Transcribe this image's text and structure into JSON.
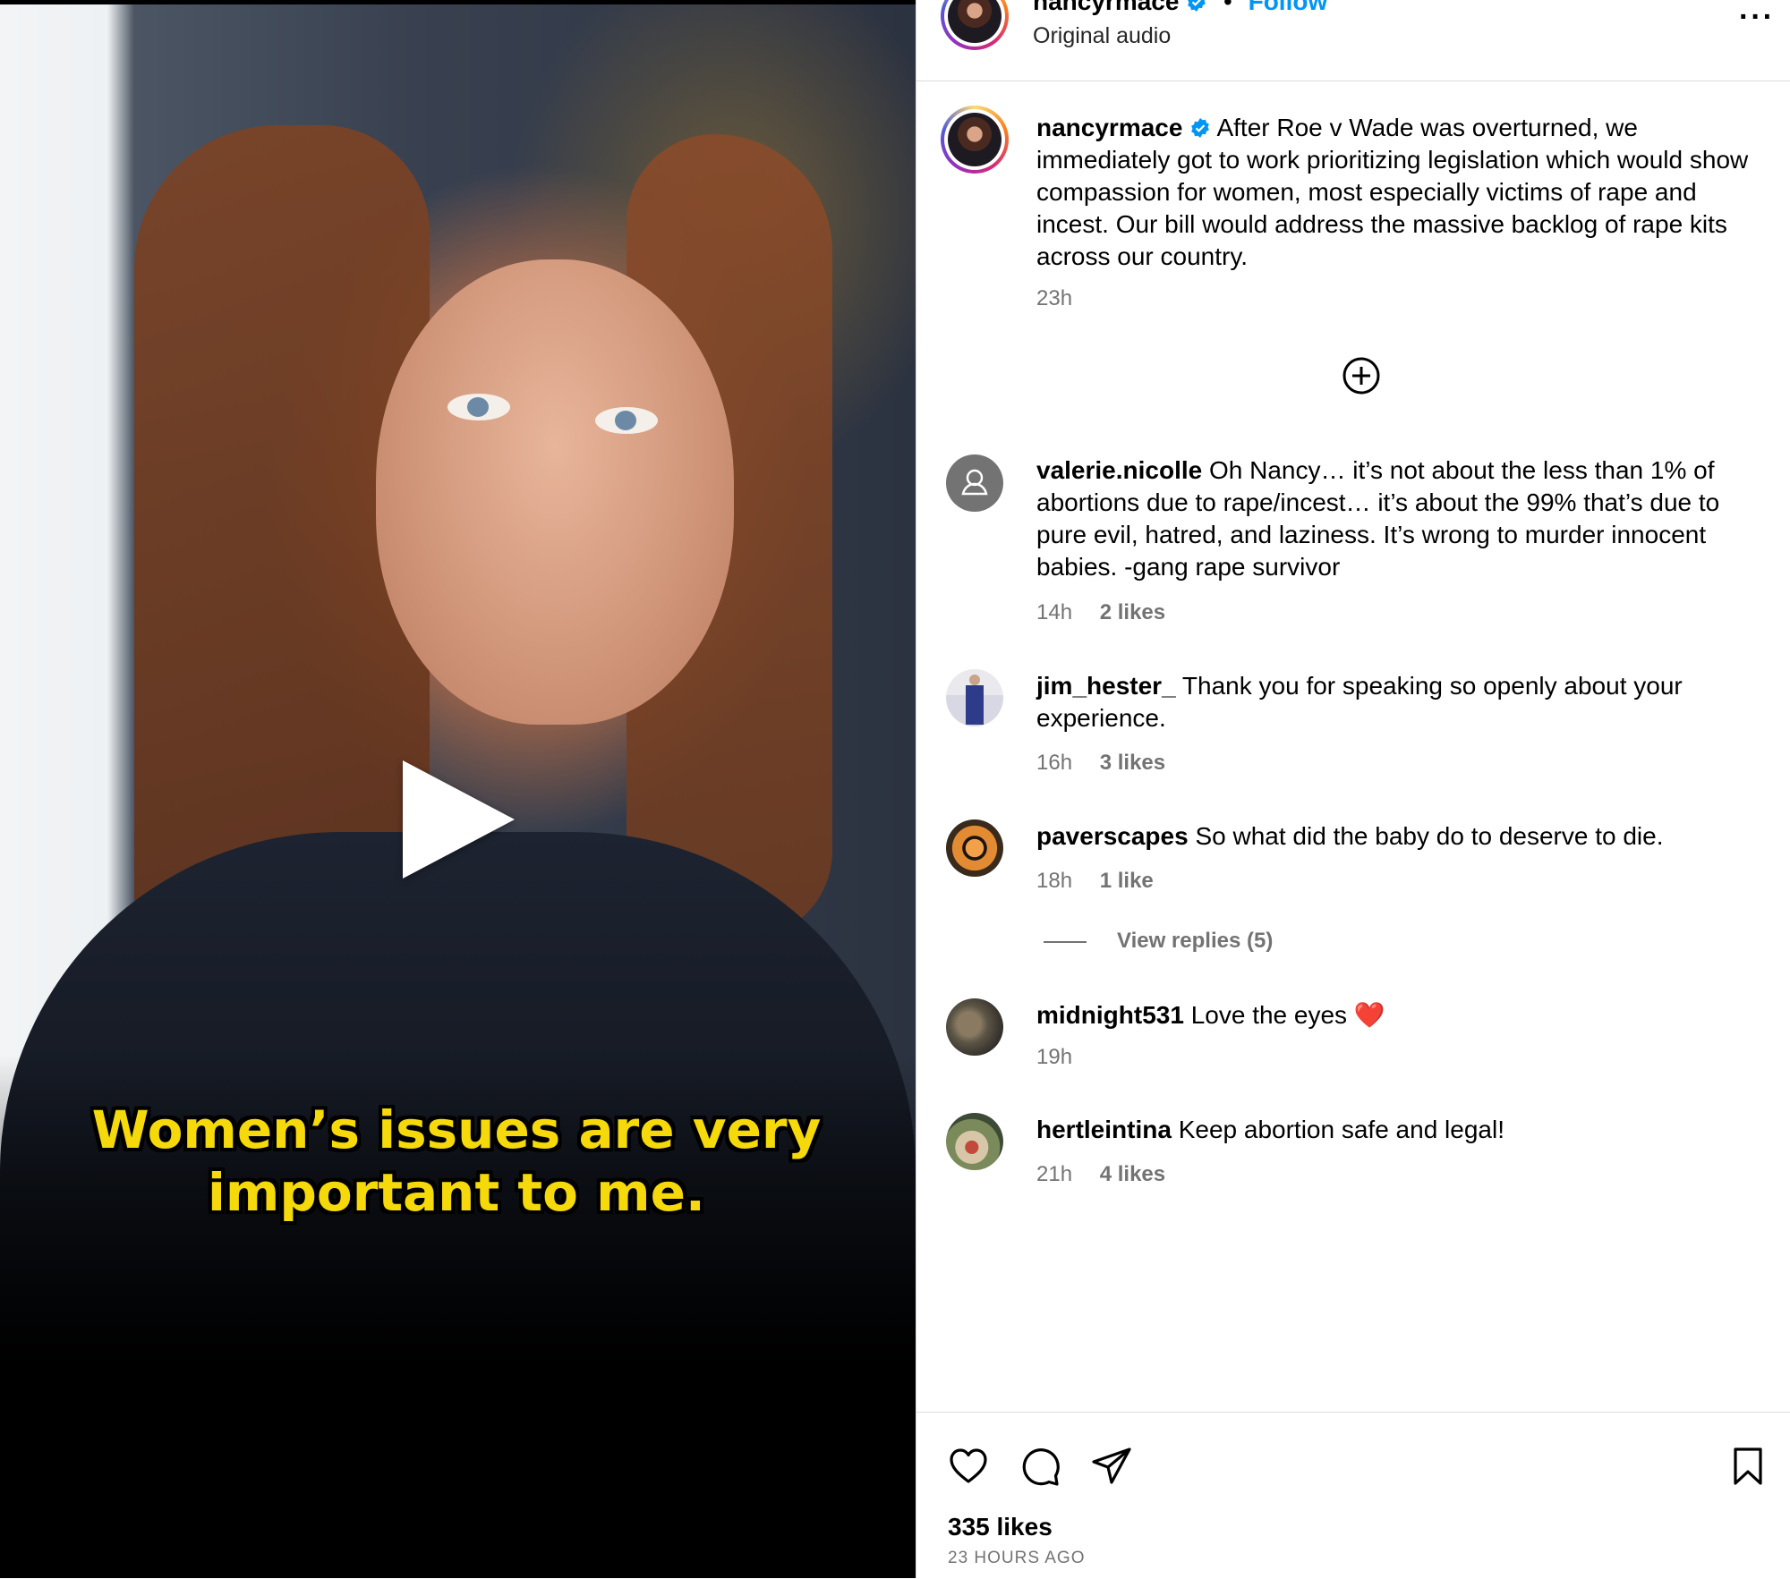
{
  "header": {
    "username": "nancyrmace",
    "separator": "•",
    "follow_label": "Follow",
    "audio_label": "Original audio",
    "more_label": "···"
  },
  "video": {
    "caption_line1": "Women’s issues are very",
    "caption_line2": "important to me."
  },
  "post": {
    "username": "nancyrmace",
    "text": "After Roe v Wade was overturned, we immediately got to work prioritizing legislation which would show compassion for women, most especially victims of rape and incest. Our bill would address the massive backlog of rape kits across our country.",
    "time": "23h"
  },
  "comments": [
    {
      "username": "valerie.nicolle",
      "text": "Oh Nancy… it’s not about the less than 1% of abortions due to rape/incest… it’s about the 99% that’s due to pure evil, hatred, and laziness. It’s wrong to murder innocent babies. -gang rape survivor",
      "time": "14h",
      "likes": "2 likes"
    },
    {
      "username": "jim_hester_",
      "text": "Thank you for speaking so openly about your experience.",
      "time": "16h",
      "likes": "3 likes"
    },
    {
      "username": "paverscapes",
      "text": "So what did the baby do to deserve to die.",
      "time": "18h",
      "likes": "1 like"
    },
    {
      "username": "midnight531",
      "text": "Love the eyes",
      "emoji": "❤️",
      "time": "19h"
    },
    {
      "username": "hertleintina",
      "text": "Keep abortion safe and legal!",
      "time": "21h",
      "likes": "4 likes"
    }
  ],
  "view_replies_label": "View replies (5)",
  "footer": {
    "likes": "335 likes",
    "time_ago": "23 HOURS AGO"
  },
  "colors": {
    "accent": "#0095f6",
    "caption": "#f5d90a",
    "secondary_text": "#737373",
    "divider": "#dbdbdb"
  }
}
